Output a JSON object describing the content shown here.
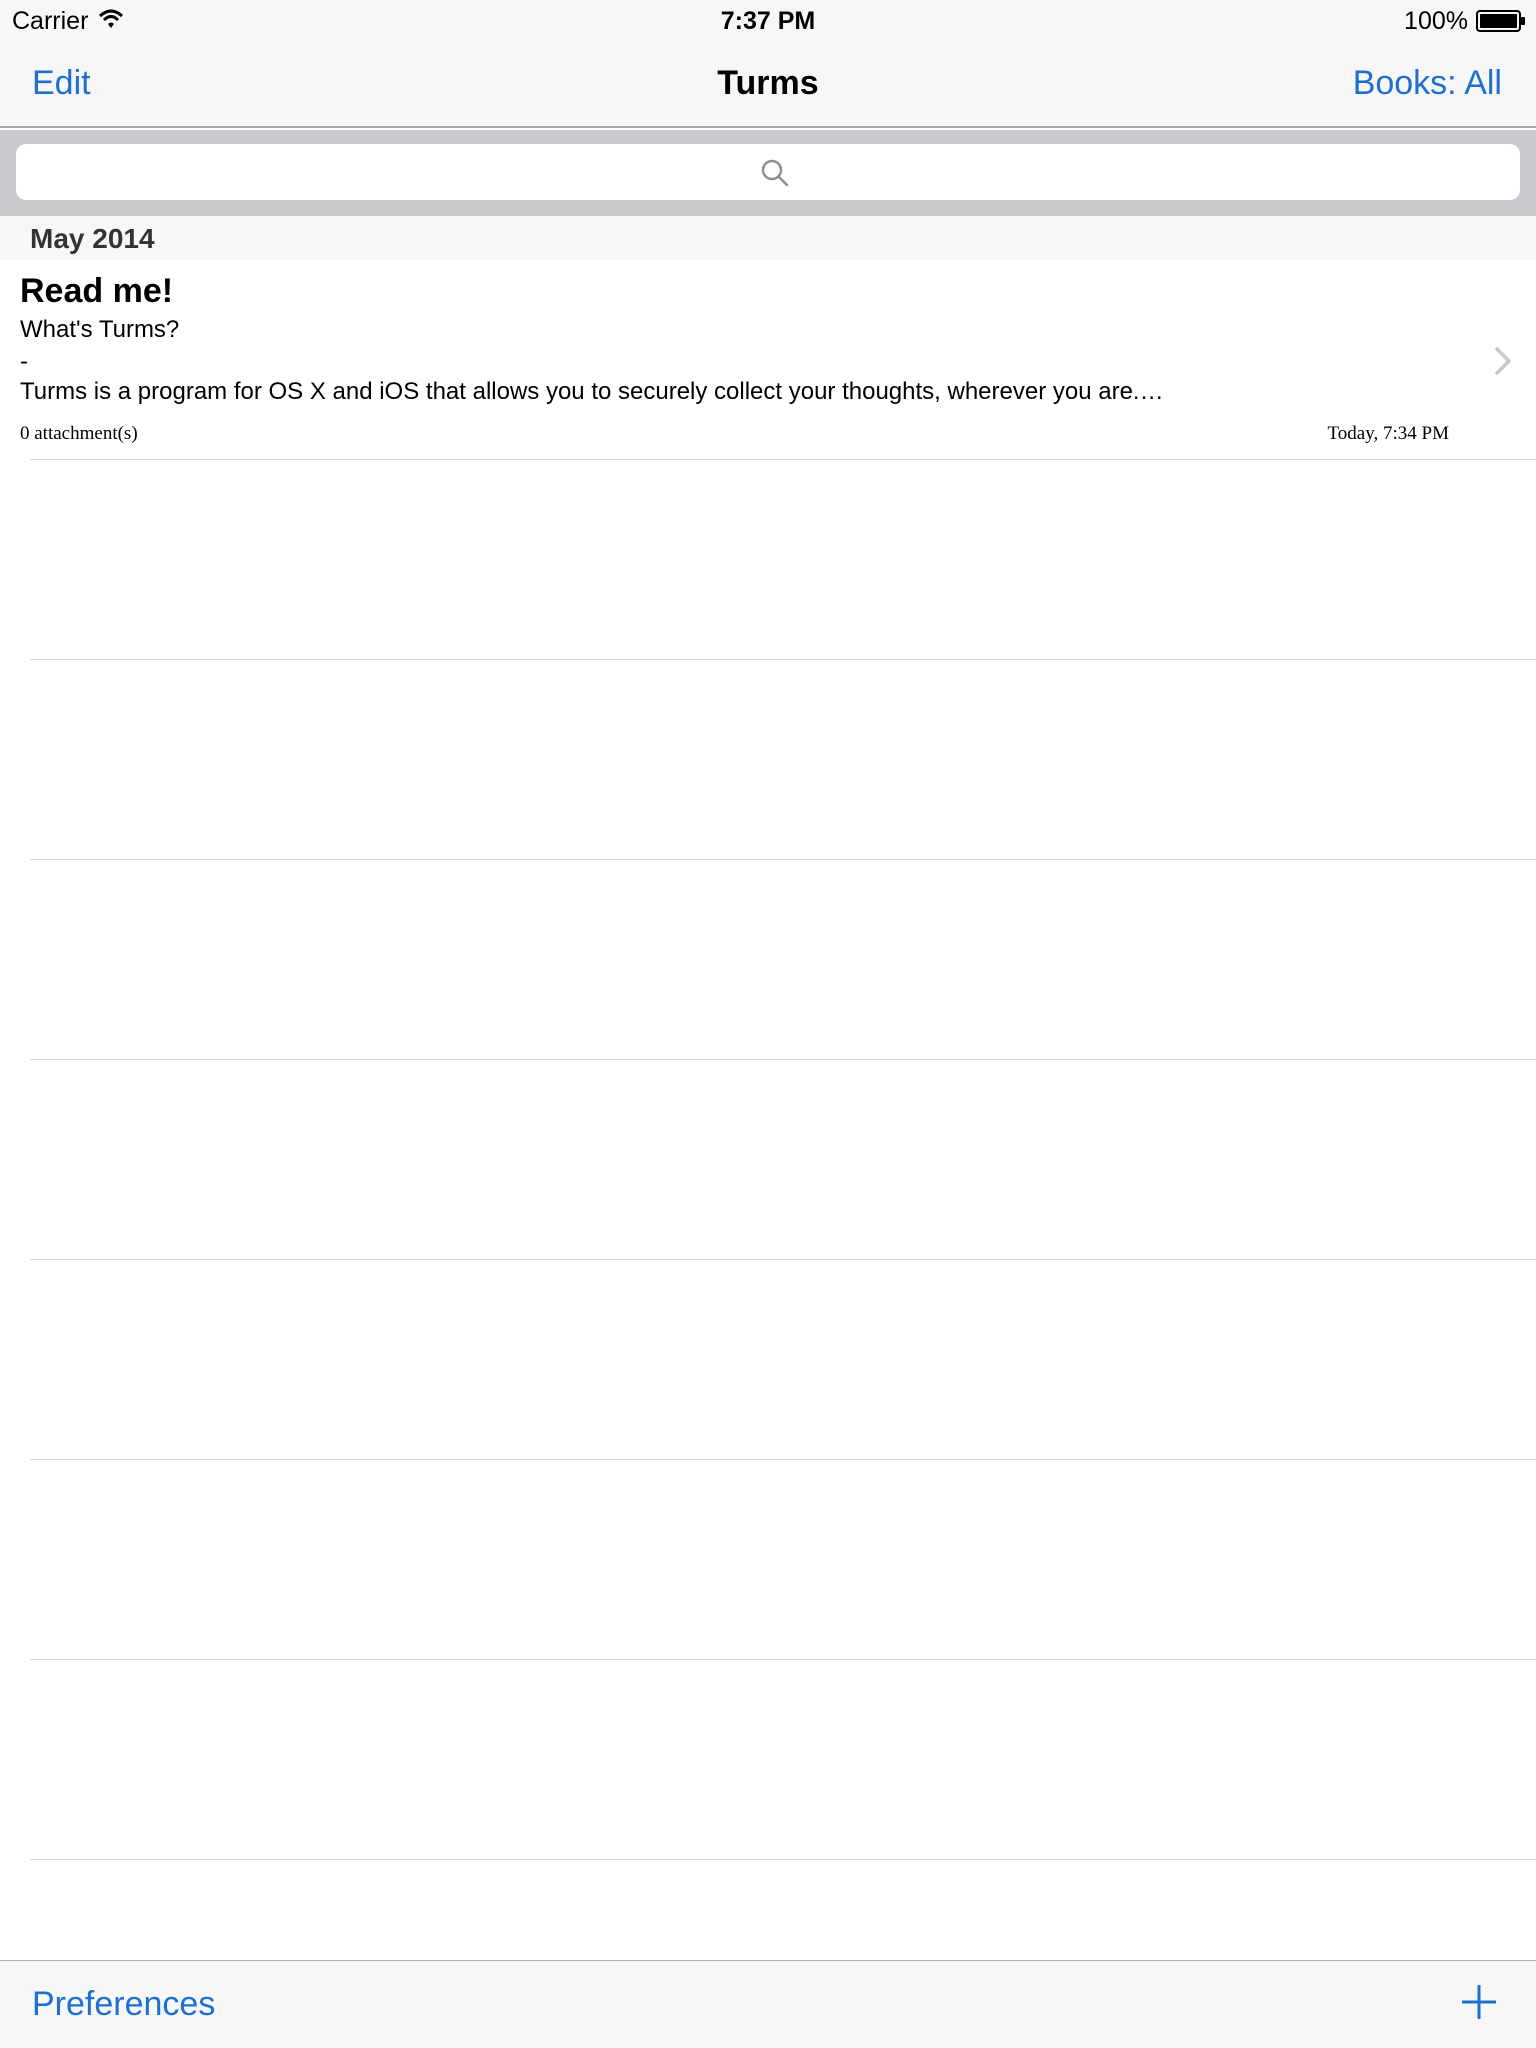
{
  "status_bar": {
    "carrier": "Carrier",
    "time": "7:37 PM",
    "battery": "100%"
  },
  "nav_bar": {
    "left_button": "Edit",
    "title": "Turms",
    "right_button": "Books: All"
  },
  "search": {
    "placeholder": ""
  },
  "sections": [
    {
      "title": "May 2014",
      "notes": [
        {
          "title": "Read me!",
          "subtitle": "What's Turms?",
          "dash": "-",
          "body": "Turms is a program for OS X and iOS that allows you to securely collect your thoughts, wherever you are.…",
          "attachments": "0 attachment(s)",
          "date": "Today, 7:34 PM"
        }
      ]
    }
  ],
  "toolbar": {
    "left_button": "Preferences",
    "add_icon": "plus-icon"
  },
  "colors": {
    "accent": "#1f6fd1",
    "bar_background": "#f7f7f7",
    "search_background": "#c9c9ce",
    "separator": "#d8d8d8"
  }
}
